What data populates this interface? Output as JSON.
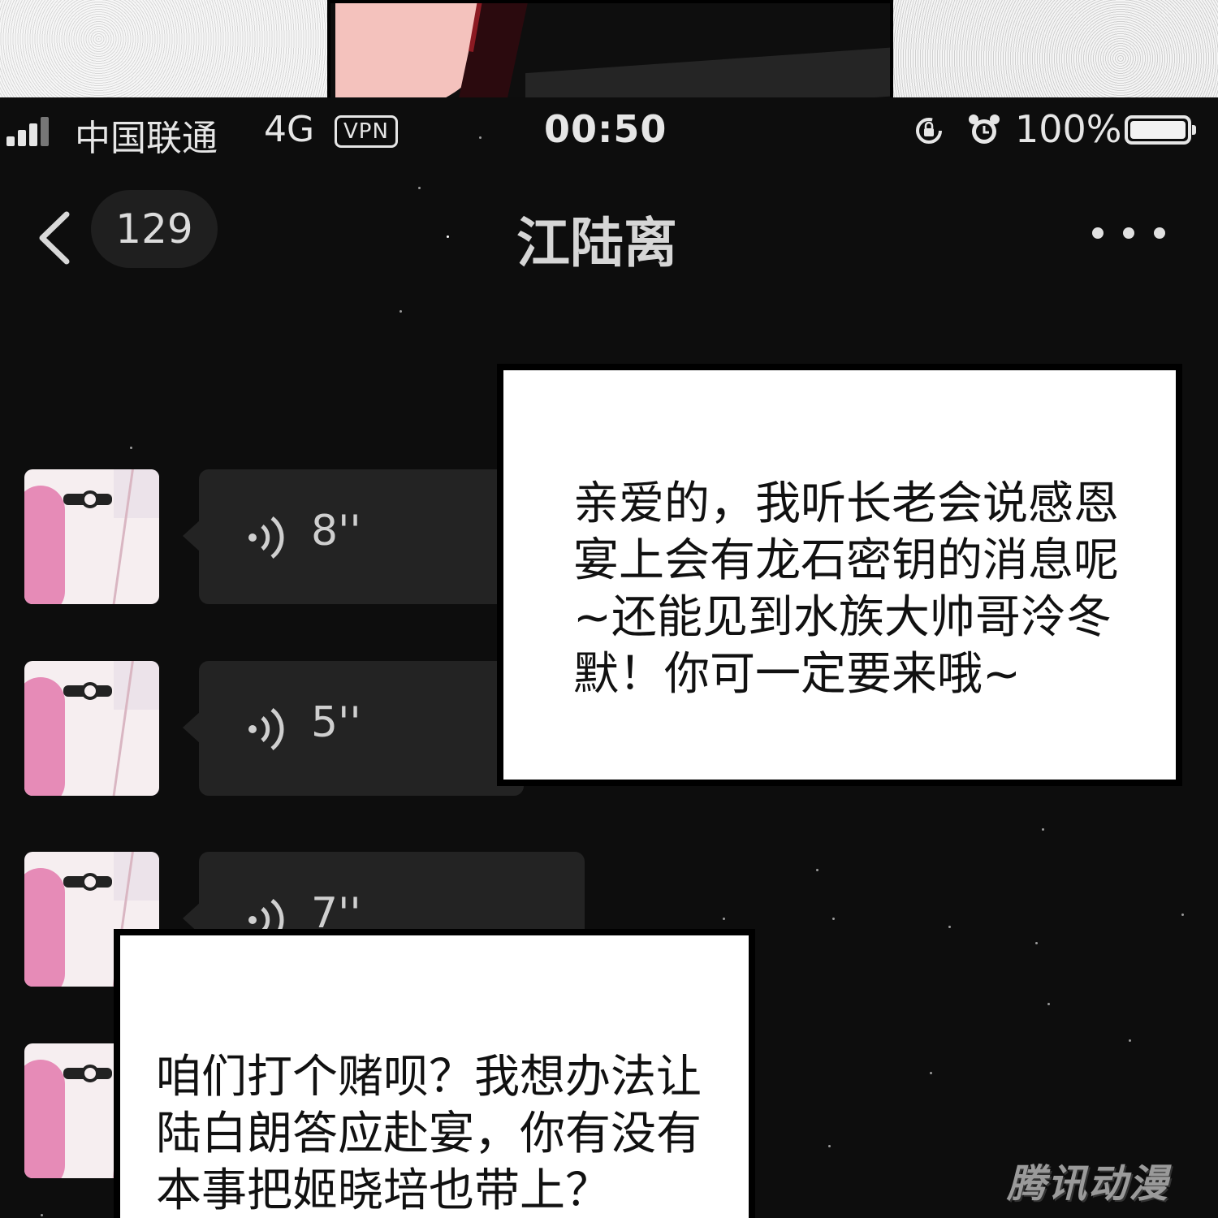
{
  "status_bar": {
    "carrier": "中国联通",
    "network": "4G",
    "vpn": "VPN",
    "time": "00:50",
    "battery": "100%"
  },
  "nav": {
    "unread_count": "129",
    "title": "江陆离"
  },
  "messages": [
    {
      "duration": "8''"
    },
    {
      "duration": "5''"
    },
    {
      "duration": "7''"
    }
  ],
  "speech_1": "亲爱的，我听长老会说感恩宴上会有龙石密钥的消息呢~还能见到水族大帅哥泠冬默！你可一定要来哦~",
  "speech_2": "咱们打个赌呗？我想办法让陆白朗答应赴宴，你有没有本事把姬晓培也带上？",
  "watermark": "腾讯动漫"
}
